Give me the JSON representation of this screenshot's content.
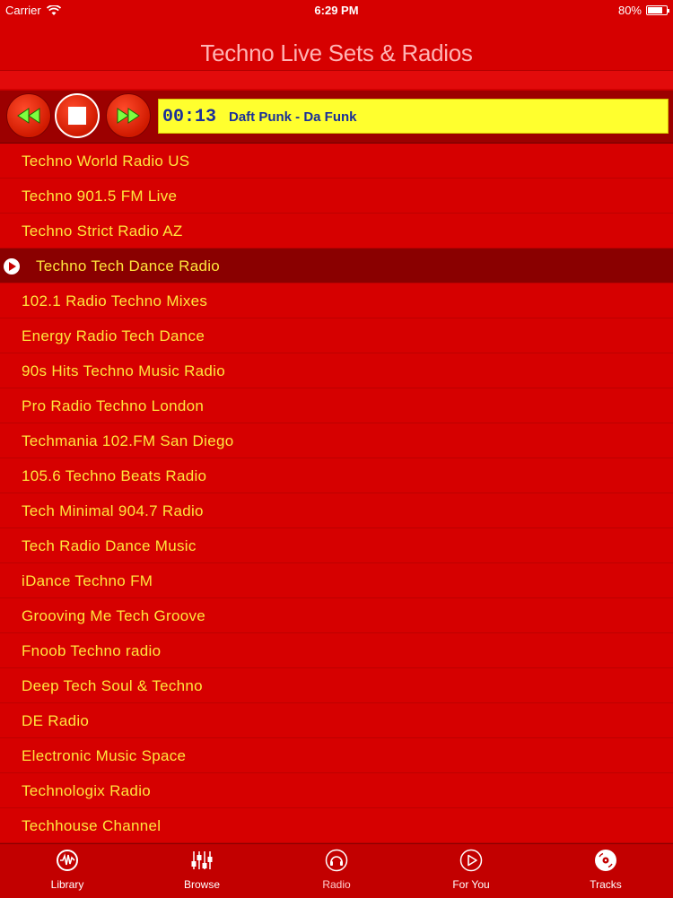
{
  "status": {
    "carrier": "Carrier",
    "time": "6:29 PM",
    "battery": "80%",
    "battery_level": 0.8
  },
  "header": {
    "title": "Techno Live Sets & Radios"
  },
  "player": {
    "elapsed": "00:13",
    "now_playing": "Daft Punk - Da Funk"
  },
  "stations": [
    {
      "name": "Techno World Radio US"
    },
    {
      "name": "Techno 901.5 FM Live"
    },
    {
      "name": "Techno Strict Radio AZ"
    },
    {
      "name": "Techno Tech Dance Radio"
    },
    {
      "name": "102.1 Radio Techno Mixes"
    },
    {
      "name": "Energy Radio Tech Dance"
    },
    {
      "name": "90s Hits Techno Music Radio"
    },
    {
      "name": "Pro Radio Techno London"
    },
    {
      "name": "Techmania 102.FM San Diego"
    },
    {
      "name": "105.6 Techno Beats Radio"
    },
    {
      "name": "Tech Minimal 904.7 Radio"
    },
    {
      "name": "Tech Radio Dance Music"
    },
    {
      "name": "iDance Techno FM"
    },
    {
      "name": "Grooving Me Tech Groove"
    },
    {
      "name": "Fnoob Techno radio"
    },
    {
      "name": "Deep Tech Soul & Techno"
    },
    {
      "name": "DE Radio"
    },
    {
      "name": "Electronic Music Space"
    },
    {
      "name": "Technologix Radio"
    },
    {
      "name": "Techhouse Channel"
    }
  ],
  "tabs": [
    {
      "label": "Library",
      "icon": "library-icon"
    },
    {
      "label": "Browse",
      "icon": "equalizer-icon"
    },
    {
      "label": "Radio",
      "icon": "headphones-icon"
    },
    {
      "label": "For You",
      "icon": "play-circle-icon"
    },
    {
      "label": "Tracks",
      "icon": "disc-icon"
    }
  ],
  "colors": {
    "background": "#d60000",
    "accent_yellow": "#ffe63c",
    "now_playing_bg": "#ffff2e",
    "active_row": "#8a0000"
  }
}
